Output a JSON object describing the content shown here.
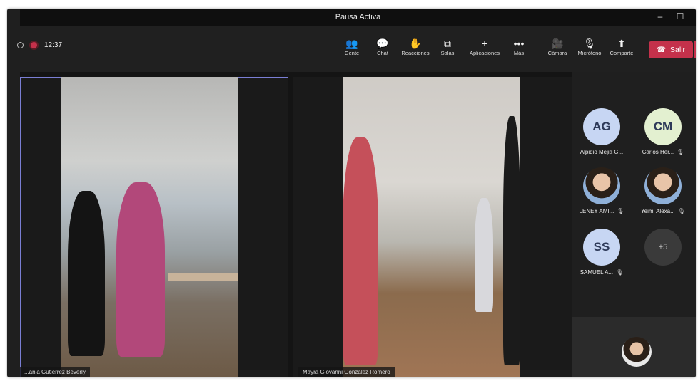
{
  "window": {
    "title": "Pausa Activa",
    "minimize": "–",
    "maximize": "☐"
  },
  "toolbar": {
    "timer": "12:37",
    "buttons": [
      {
        "label": "Gente",
        "icon": "people-icon",
        "glyph": "👥"
      },
      {
        "label": "Chat",
        "icon": "chat-icon",
        "glyph": "💬"
      },
      {
        "label": "Reacciones",
        "icon": "reactions-icon",
        "glyph": "✋"
      },
      {
        "label": "Salas",
        "icon": "rooms-icon",
        "glyph": "⧉"
      },
      {
        "label": "Aplicaciones",
        "icon": "apps-icon",
        "glyph": "+"
      },
      {
        "label": "Más",
        "icon": "more-icon",
        "glyph": "•••"
      },
      {
        "label": "Cámara",
        "icon": "camera-off-icon",
        "glyph": "🎥"
      },
      {
        "label": "Micrófono",
        "icon": "mic-off-icon",
        "glyph": "🎙"
      },
      {
        "label": "Comparte",
        "icon": "share-icon",
        "glyph": "⬆"
      }
    ],
    "leave_label": "Salir",
    "leave_icon": "☎"
  },
  "stage": {
    "tiles": [
      {
        "name": "...ania Gutierrez Beverly"
      },
      {
        "name": "Mayra Giovanni Gonzalez Romero"
      }
    ]
  },
  "participants": [
    {
      "initials": "AG",
      "name": "Alpidio Mejia G...",
      "color": "#c7d6f3"
    },
    {
      "initials": "CM",
      "name": "Carlos Her...",
      "color": "#e3f0d0"
    },
    {
      "initials": "",
      "name": "LENEY AMI..."
    },
    {
      "initials": "",
      "name": "Yeimi Alexa..."
    },
    {
      "initials": "SS",
      "name": "SAMUEL A...",
      "color": "#c7d6f3"
    },
    {
      "initials": "+5",
      "name": ""
    }
  ],
  "colors": {
    "accent": "#c4314b",
    "active_outline": "#7a7ed4"
  }
}
